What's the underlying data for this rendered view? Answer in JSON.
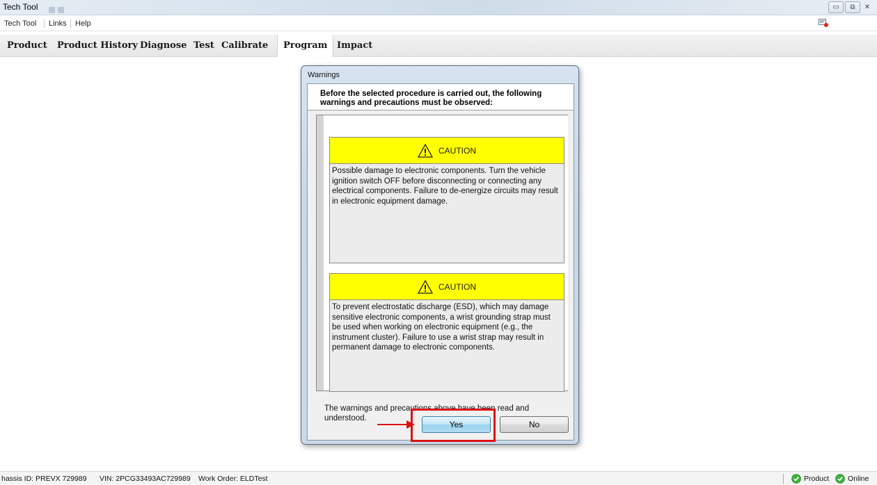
{
  "window": {
    "title": "Tech Tool",
    "controls": {
      "minimize": "▭",
      "restore": "⧉",
      "close": "✕"
    }
  },
  "menu": {
    "items": [
      "Tech Tool",
      "Links",
      "Help"
    ]
  },
  "nav": {
    "tabs": [
      "Product",
      "Product History",
      "Diagnose",
      "Test",
      "Calibrate",
      "Program",
      "Impact"
    ],
    "active": "Program"
  },
  "dialog": {
    "title": "Warnings",
    "header": "Before the selected procedure is carried out, the following warnings and precautions must be observed:",
    "cautions": [
      {
        "label": "CAUTION",
        "text": "Possible damage to electronic components. Turn the vehicle ignition switch OFF before disconnecting or connecting any electrical components. Failure to de-energize circuits may result in electronic equipment damage."
      },
      {
        "label": "CAUTION",
        "text": "To prevent electrostatic discharge (ESD), which may damage sensitive electronic components, a wrist grounding strap must be used when working on electronic equipment (e.g., the instrument cluster). Failure to use a wrist strap may result in permanent damage to electronic components."
      }
    ],
    "acknowledgement": "The warnings and precautions above have been read and understood.",
    "yes_label": "Yes",
    "no_label": "No"
  },
  "status": {
    "chassis": "hassis ID: PREVX 729989",
    "vin": "VIN: 2PCG33493AC729989",
    "work_order": "Work Order: ELDTest",
    "product": "Product",
    "online": "Online"
  },
  "colors": {
    "caution_header": "#ffff00",
    "highlight": "#dd1111",
    "status_ok": "#3cb43c"
  }
}
